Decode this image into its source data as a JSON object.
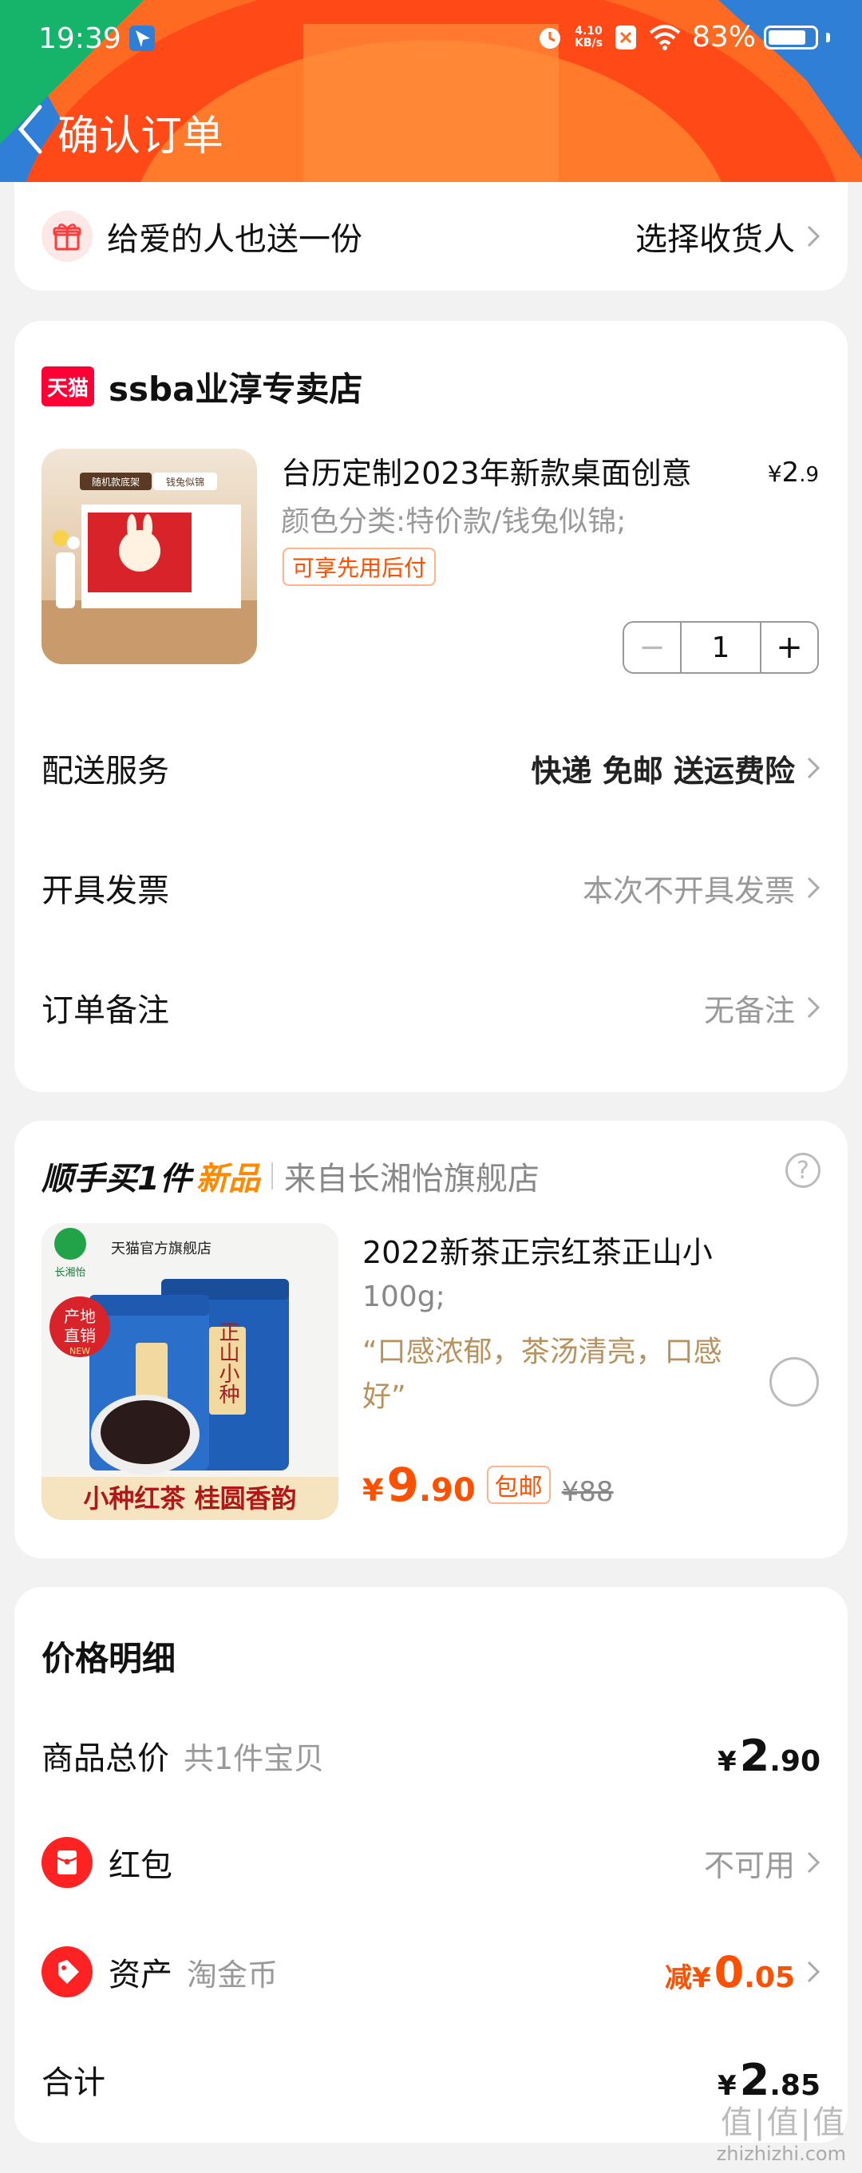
{
  "status_bar": {
    "time": "19:39",
    "net_speed_value": "4.10",
    "net_speed_unit": "KB/s",
    "battery_percent": "83%",
    "battery_level": 0.83,
    "icons": [
      "navigation-icon",
      "alarm-icon",
      "sim-x-icon",
      "wifi-icon",
      "battery-icon"
    ]
  },
  "header": {
    "title": "确认订单",
    "back_icon": "chevron-left-icon",
    "colors": {
      "orange": "#ff5a1f",
      "red": "#ff3a12",
      "green": "#16b36b",
      "blue": "#2f7fd6"
    }
  },
  "gift": {
    "label": "给爱的人也送一份",
    "action": "选择收货人",
    "icon": "gift-icon"
  },
  "store": {
    "badge": "天猫",
    "name": "ssba业淳专卖店",
    "product": {
      "title": "台历定制2023年新款桌面创意",
      "price_symbol": "¥",
      "price_int": "2",
      "price_dec": ".9",
      "spec": "颜色分类:特价款/钱兔似锦;",
      "tag": "可享先用后付",
      "image_labels": [
        "随机款底架",
        "钱兔似锦"
      ],
      "quantity": "1",
      "minus": "−",
      "plus": "+"
    },
    "options": [
      {
        "label": "配送服务",
        "value": "快递 免邮 送运费险"
      },
      {
        "label": "开具发票",
        "value": "本次不开具发票"
      },
      {
        "label": "订单备注",
        "value": "无备注"
      }
    ]
  },
  "upsell": {
    "label": "顺手买1件",
    "new": "新品",
    "from": "来自长湘怡旗舰店",
    "help": "?",
    "product": {
      "title": "2022新茶正宗红茶正山小",
      "weight": "100g;",
      "quote": "“口感浓郁，茶汤清亮，口感好”",
      "price_symbol": "¥",
      "price_int": "9",
      "price_dec": ".90",
      "shipping": "包邮",
      "original": "¥88",
      "image_texts": {
        "brand": "长湘怡",
        "shop": "天猫官方旗舰店",
        "badge_line1": "产地",
        "badge_line2": "直销",
        "badge_new": "NEW",
        "can_label": "正山小种",
        "banner": "小种红茶 桂圆香韵"
      }
    }
  },
  "price_detail": {
    "title": "价格明细",
    "goods_total": {
      "label": "商品总价",
      "sub": "共1件宝贝",
      "symbol": "¥",
      "int": "2",
      "dec": ".90"
    },
    "red_packet": {
      "label": "红包",
      "value": "不可用",
      "icon": "red-packet-icon"
    },
    "assets": {
      "label": "资产",
      "sub": "淘金币",
      "prefix": "减",
      "symbol": "¥",
      "int": "0",
      "dec": ".05",
      "icon": "coin-tag-icon"
    },
    "total": {
      "label": "合计",
      "symbol": "¥",
      "int": "2",
      "dec": ".85"
    }
  },
  "watermark": {
    "text": "值|值|值",
    "sub": "zhizhizhi.com"
  }
}
